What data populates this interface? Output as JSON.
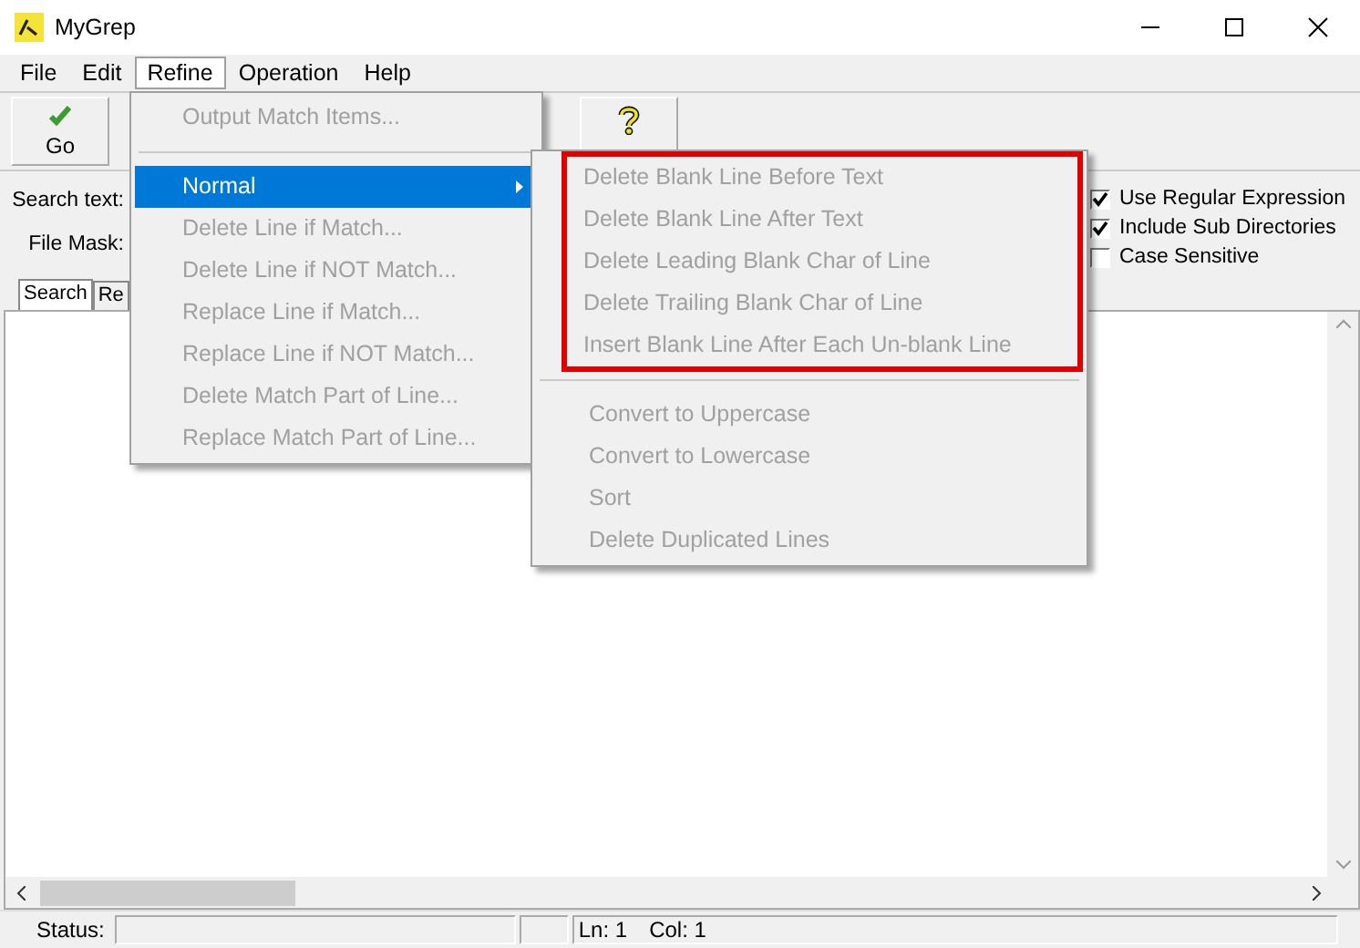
{
  "window": {
    "title": "MyGrep"
  },
  "menubar": [
    {
      "label": "File",
      "selected": false
    },
    {
      "label": "Edit",
      "selected": false
    },
    {
      "label": "Refine",
      "selected": true
    },
    {
      "label": "Operation",
      "selected": false
    },
    {
      "label": "Help",
      "selected": false
    }
  ],
  "toolbar": [
    {
      "kind": "go",
      "label": "Go"
    },
    {
      "kind": "help"
    }
  ],
  "form": {
    "labels": [
      "Search text:",
      "File Mask:"
    ],
    "options": [
      {
        "label": "Use Regular Expression",
        "checked": true
      },
      {
        "label": "Include Sub Directories",
        "checked": true
      },
      {
        "label": "Case Sensitive",
        "checked": false
      }
    ]
  },
  "tabs": [
    {
      "label": "Search",
      "selected": true
    },
    {
      "label": "Re",
      "selected": false
    }
  ],
  "status_bar": {
    "label": "Status:",
    "line": "Ln: 1",
    "column": "Col: 1"
  },
  "refine_menu": [
    {
      "label": "Output Match Items...",
      "disabled": true,
      "selected": false,
      "submenu": false
    },
    {
      "kind": "separator"
    },
    {
      "label": "Normal",
      "disabled": false,
      "selected": true,
      "submenu": true
    },
    {
      "label": "Delete Line if Match...",
      "disabled": true,
      "selected": false,
      "submenu": false
    },
    {
      "label": "Delete Line if NOT Match...",
      "disabled": true,
      "selected": false,
      "submenu": false
    },
    {
      "label": "Replace Line if Match...",
      "disabled": true,
      "selected": false,
      "submenu": false
    },
    {
      "label": "Replace Line if NOT Match...",
      "disabled": true,
      "selected": false,
      "submenu": false
    },
    {
      "label": "Delete Match Part of Line...",
      "disabled": true,
      "selected": false,
      "submenu": false
    },
    {
      "label": "Replace Match Part of Line...",
      "disabled": true,
      "selected": false,
      "submenu": false
    }
  ],
  "normal_submenu": [
    {
      "highlighted": true,
      "items": [
        {
          "label": "Delete Blank Line Before Text",
          "disabled": true
        },
        {
          "label": "Delete Blank Line After Text",
          "disabled": true
        },
        {
          "label": "Delete Leading Blank Char of Line",
          "disabled": true
        },
        {
          "label": "Delete Trailing Blank Char of Line",
          "disabled": true
        },
        {
          "label": "Insert Blank Line After Each Un-blank Line",
          "disabled": true
        }
      ]
    },
    {
      "highlighted": false,
      "items": [
        {
          "label": "Convert to Uppercase",
          "disabled": true
        },
        {
          "label": "Convert to Lowercase",
          "disabled": true
        },
        {
          "label": "Sort",
          "disabled": true
        },
        {
          "label": "Delete Duplicated Lines",
          "disabled": true
        }
      ]
    }
  ]
}
